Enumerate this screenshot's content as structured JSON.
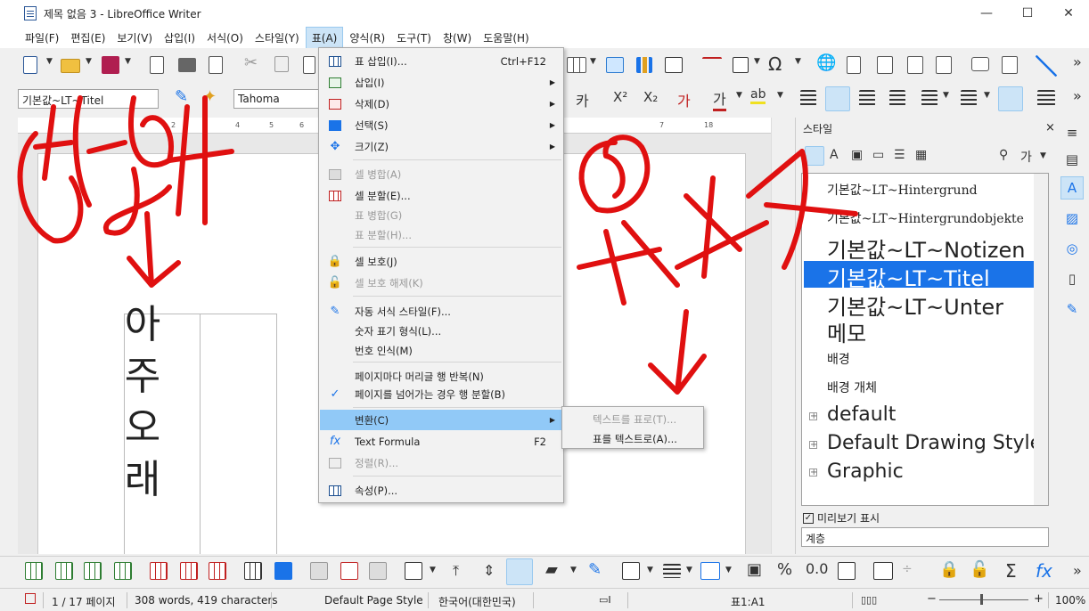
{
  "window": {
    "title": "제목 없음 3 - LibreOffice Writer",
    "minimize": "—",
    "maximize": "☐",
    "close": "✕"
  },
  "menubar": [
    "파일(F)",
    "편집(E)",
    "보기(V)",
    "삽입(I)",
    "서식(O)",
    "스타일(Y)",
    "표(A)",
    "양식(R)",
    "도구(T)",
    "창(W)",
    "도움말(H)"
  ],
  "formatting": {
    "paragraph_style": "기본값~LT~Titel",
    "font_name": "Tahoma"
  },
  "ruler_numbers": [
    "1",
    "2",
    "3",
    "4",
    "5",
    "6",
    "7",
    "18"
  ],
  "document": {
    "table_chars": [
      "아",
      "주",
      "오",
      "래"
    ]
  },
  "table_menu": {
    "items": [
      {
        "label": "표 삽입(I)...",
        "shortcut": "Ctrl+F12",
        "icon": "table-insert-icon"
      },
      {
        "label": "삽입(I)",
        "submenu": true,
        "icon": "insert-rows-icon"
      },
      {
        "label": "삭제(D)",
        "submenu": true,
        "icon": "delete-table-icon"
      },
      {
        "label": "선택(S)",
        "submenu": true,
        "icon": "select-table-icon"
      },
      {
        "label": "크기(Z)",
        "submenu": true,
        "icon": "size-icon"
      },
      {
        "label": "셀 병합(A)",
        "disabled": true,
        "icon": "merge-cells-icon"
      },
      {
        "label": "셀 분할(E)...",
        "icon": "split-cells-icon"
      },
      {
        "label": "표 병합(G)",
        "disabled": true
      },
      {
        "label": "표 분할(H)...",
        "disabled": true
      },
      {
        "label": "셀 보호(J)",
        "icon": "lock-icon"
      },
      {
        "label": "셀 보호 해제(K)",
        "disabled": true,
        "icon": "unlock-icon"
      },
      {
        "label": "자동 서식 스타일(F)...",
        "icon": "autoformat-icon"
      },
      {
        "label": "숫자 표기 형식(L)..."
      },
      {
        "label": "번호 인식(M)"
      },
      {
        "label": "페이지마다 머리글 행 반복(N)"
      },
      {
        "label": "페이지를 넘어가는 경우 행 분할(B)",
        "checked": true
      },
      {
        "label": "변환(C)",
        "submenu": true,
        "highlighted": true
      },
      {
        "label": "Text Formula",
        "shortcut": "F2",
        "icon": "fx-icon"
      },
      {
        "label": "정렬(R)...",
        "disabled": true,
        "icon": "sort-icon"
      },
      {
        "label": "속성(P)...",
        "icon": "table-properties-icon"
      }
    ]
  },
  "convert_submenu": {
    "items": [
      {
        "label": "텍스트를 표로(T)...",
        "disabled": true
      },
      {
        "label": "표를 텍스트로(A)..."
      }
    ]
  },
  "sidebar": {
    "title": "스타일",
    "close": "×",
    "styles": [
      {
        "label": "기본값~LT~Hintergrund",
        "size": "small"
      },
      {
        "label": "기본값~LT~Hintergrundobjekte",
        "size": "small"
      },
      {
        "label": "기본값~LT~Notizen",
        "size": "large"
      },
      {
        "label": "기본값~LT~Titel",
        "size": "large",
        "selected": true
      },
      {
        "label": "기본값~LT~Unter",
        "size": "large"
      },
      {
        "label": "메모",
        "size": "large"
      },
      {
        "label": "배경",
        "size": "small"
      },
      {
        "label": "배경 개체",
        "size": "small"
      },
      {
        "label": "default",
        "size": "large",
        "expandable": true
      },
      {
        "label": "Default Drawing Style",
        "size": "large",
        "expandable": true
      },
      {
        "label": "Graphic",
        "size": "large",
        "expandable": true
      }
    ],
    "preview_label": "미리보기 표시",
    "filter_value": "계층"
  },
  "statusbar": {
    "page": "1 / 17 페이지",
    "words": "308 words, 419 characters",
    "page_style": "Default Page Style",
    "language": "한국어(대한민국)",
    "cell": "표1:A1",
    "zoom": "100%"
  },
  "colors": {
    "menu_highlight": "#91c9f7",
    "selection_blue": "#1a73e8",
    "annotation_red": "#e01010"
  }
}
